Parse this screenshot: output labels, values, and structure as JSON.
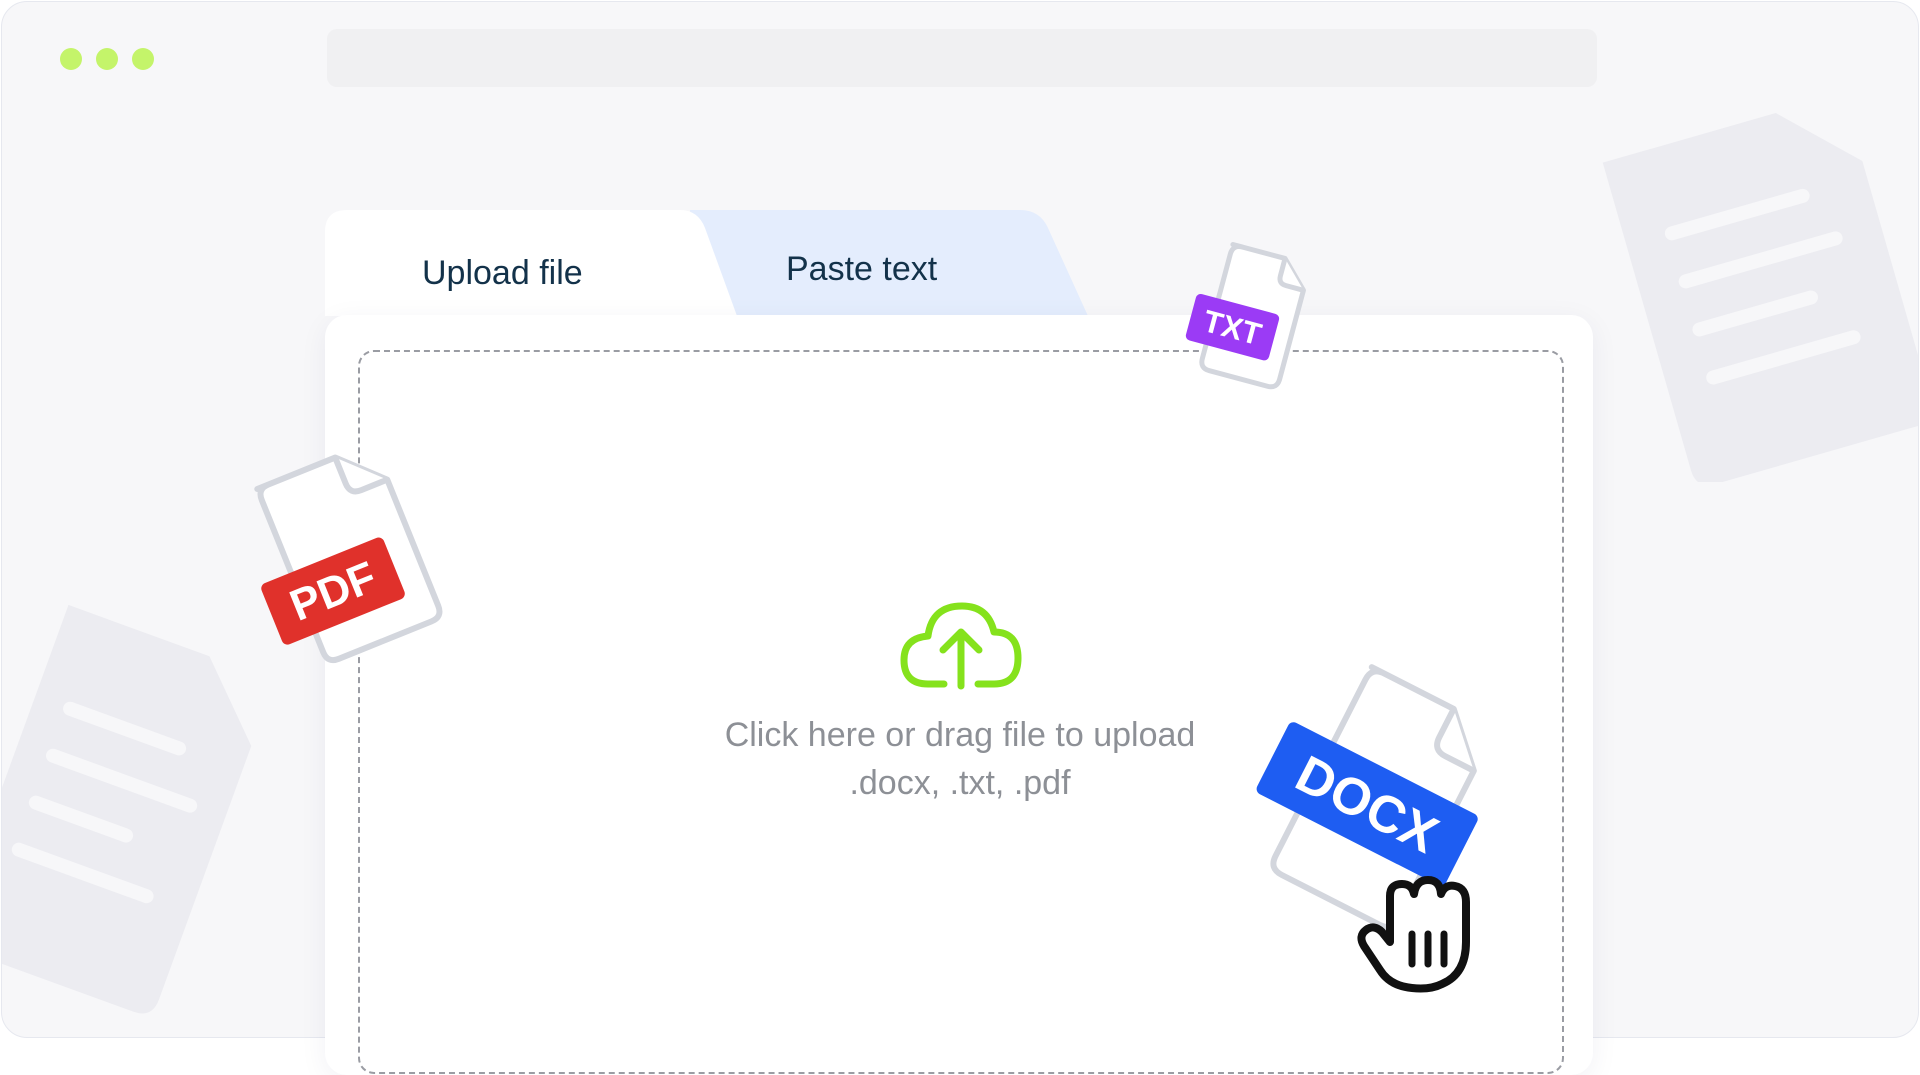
{
  "window": {
    "dot_color": "#c4f46a"
  },
  "tabs": [
    {
      "label": "Upload file",
      "active": true
    },
    {
      "label": "Paste text",
      "active": false
    }
  ],
  "dropzone": {
    "main_text": "Click here or drag file to upload",
    "formats_text": ".docx, .txt, .pdf",
    "icon": "cloud-upload-icon"
  },
  "file_badges": {
    "pdf": {
      "label": "PDF",
      "color": "#e0312b"
    },
    "txt": {
      "label": "TXT",
      "color": "#9b3bf5"
    },
    "docx": {
      "label": "DOCX",
      "color": "#1e5df2"
    }
  },
  "colors": {
    "accent_green": "#85e21c",
    "tab_inactive_bg": "#e4edfd",
    "text_dark": "#13324a"
  }
}
